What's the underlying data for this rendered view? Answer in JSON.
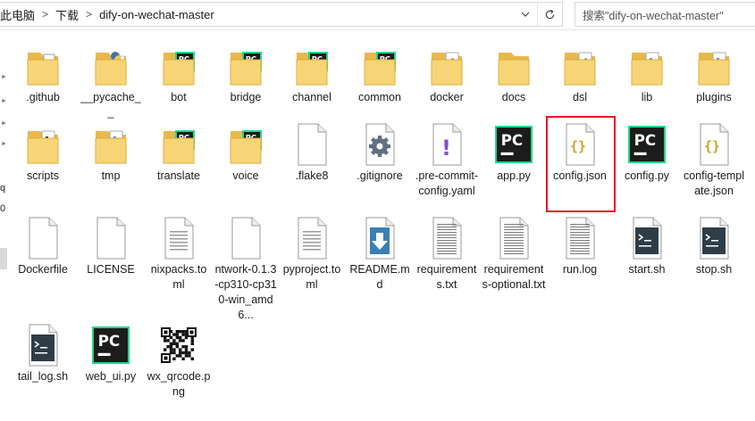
{
  "address": {
    "crumbs": [
      "此电脑",
      "下载",
      "dify-on-wechat-master"
    ],
    "separator": ">"
  },
  "search": {
    "placeholder": "搜索\"dify-on-wechat-master\""
  },
  "nav": {
    "letters": [
      "q",
      "0"
    ]
  },
  "files": [
    {
      "name": ".github",
      "type": "folder"
    },
    {
      "name": "__pycache__",
      "type": "folder-python"
    },
    {
      "name": "bot",
      "type": "folder-pycharm"
    },
    {
      "name": "bridge",
      "type": "folder-pycharm"
    },
    {
      "name": "channel",
      "type": "folder-pycharm"
    },
    {
      "name": "common",
      "type": "folder-pycharm"
    },
    {
      "name": "docker",
      "type": "folder-purple-excl"
    },
    {
      "name": "docs",
      "type": "folder-plain"
    },
    {
      "name": "dsl",
      "type": "folder-purple-excl"
    },
    {
      "name": "lib",
      "type": "folder-docs"
    },
    {
      "name": "plugins",
      "type": "folder-docs"
    },
    {
      "name": "scripts",
      "type": "folder-docs-dark"
    },
    {
      "name": "tmp",
      "type": "folder-docs"
    },
    {
      "name": "translate",
      "type": "folder-pycharm"
    },
    {
      "name": "voice",
      "type": "folder-pycharm"
    },
    {
      "name": ".flake8",
      "type": "blank"
    },
    {
      "name": ".gitignore",
      "type": "gear"
    },
    {
      "name": ".pre-commit-config.yaml",
      "type": "purple-excl"
    },
    {
      "name": "app.py",
      "type": "pycharm"
    },
    {
      "name": "config.json",
      "type": "json",
      "selected": true
    },
    {
      "name": "config.py",
      "type": "pycharm"
    },
    {
      "name": "config-template.json",
      "type": "json"
    },
    {
      "name": "Dockerfile",
      "type": "blank"
    },
    {
      "name": "LICENSE",
      "type": "blank"
    },
    {
      "name": "nixpacks.toml",
      "type": "text"
    },
    {
      "name": "ntwork-0.1.3-cp310-cp310-win_amd6...",
      "type": "blank"
    },
    {
      "name": "pyproject.toml",
      "type": "text"
    },
    {
      "name": "README.md",
      "type": "download"
    },
    {
      "name": "requirements.txt",
      "type": "text-lined"
    },
    {
      "name": "requirements-optional.txt",
      "type": "text-lined"
    },
    {
      "name": "run.log",
      "type": "text-lined"
    },
    {
      "name": "start.sh",
      "type": "shell"
    },
    {
      "name": "stop.sh",
      "type": "shell"
    },
    {
      "name": "tail_log.sh",
      "type": "shell"
    },
    {
      "name": "web_ui.py",
      "type": "pycharm"
    },
    {
      "name": "wx_qrcode.png",
      "type": "qr"
    }
  ],
  "labels": {
    "pycharm_badge": "PC"
  }
}
